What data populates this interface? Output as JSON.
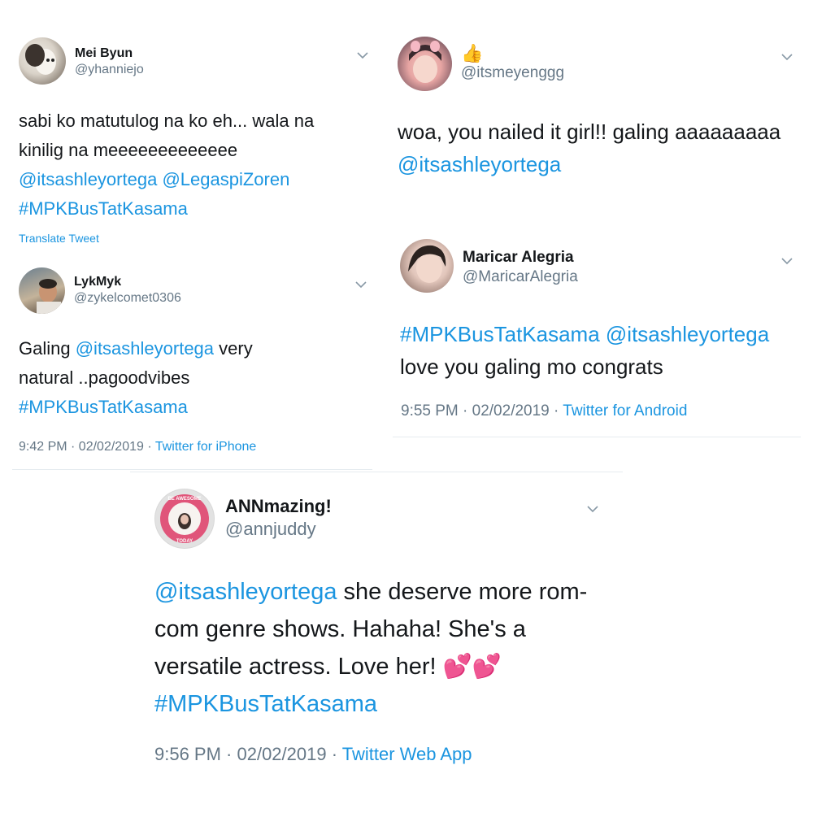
{
  "tweets": [
    {
      "name": "Mei Byun",
      "handle": "@yhanniejo",
      "lines": [
        [
          {
            "t": "sabi ko matutulog na ko eh... wala na"
          }
        ],
        [
          {
            "t": "kinilig na meeeeeeeeeeeee"
          }
        ],
        [
          {
            "t": "@itsashleyortega",
            "link": true
          },
          {
            "t": " "
          },
          {
            "t": "@LegaspiZoren",
            "link": true
          }
        ],
        [
          {
            "t": "#MPKBusTatKasama",
            "link": true
          }
        ]
      ],
      "translate": "Translate Tweet"
    },
    {
      "name": "LykMyk",
      "handle": "@zykelcomet0306",
      "lines": [
        [
          {
            "t": "Galing "
          },
          {
            "t": "@itsashleyortega",
            "link": true
          },
          {
            "t": " very"
          }
        ],
        [
          {
            "t": "natural ..pagoodvibes"
          }
        ],
        [
          {
            "t": "#MPKBusTatKasama",
            "link": true
          }
        ]
      ],
      "time": "9:42 PM · 02/02/2019 · ",
      "source": "Twitter for iPhone"
    },
    {
      "name": "👍",
      "handle": "@itsmeyenggg",
      "lines": [
        [
          {
            "t": "woa, you nailed it girl!! galing aaaaaaaaa"
          }
        ],
        [
          {
            "t": "@itsashleyortega",
            "link": true
          }
        ]
      ]
    },
    {
      "name": "Maricar Alegria",
      "handle": "@MaricarAlegria",
      "lines": [
        [
          {
            "t": "#MPKBusTatKasama",
            "link": true
          },
          {
            "t": " "
          },
          {
            "t": "@itsashleyortega",
            "link": true
          }
        ],
        [
          {
            "t": "love you galing mo congrats"
          }
        ]
      ],
      "time": "9:55 PM · 02/02/2019 · ",
      "source": "Twitter for Android"
    },
    {
      "name": "ANNmazing!",
      "handle": "@annjuddy",
      "lines": [
        [
          {
            "t": "@itsashleyortega",
            "link": true
          },
          {
            "t": " she deserve more rom-"
          }
        ],
        [
          {
            "t": "com genre shows. Hahaha! She's a"
          }
        ],
        [
          {
            "t": "versatile actress. Love her! 💕💕"
          }
        ],
        [
          {
            "t": "#MPKBusTatKasama",
            "link": true
          }
        ]
      ],
      "time": "9:56 PM · 02/02/2019 · ",
      "source": "Twitter Web App",
      "badge_text": "BE AWESOME TODAY"
    }
  ],
  "colors": {
    "link": "#1b95e0",
    "secondary": "#657786",
    "divider": "#e6ecf0"
  },
  "icons": {
    "chevron": "chevron-down-icon"
  }
}
